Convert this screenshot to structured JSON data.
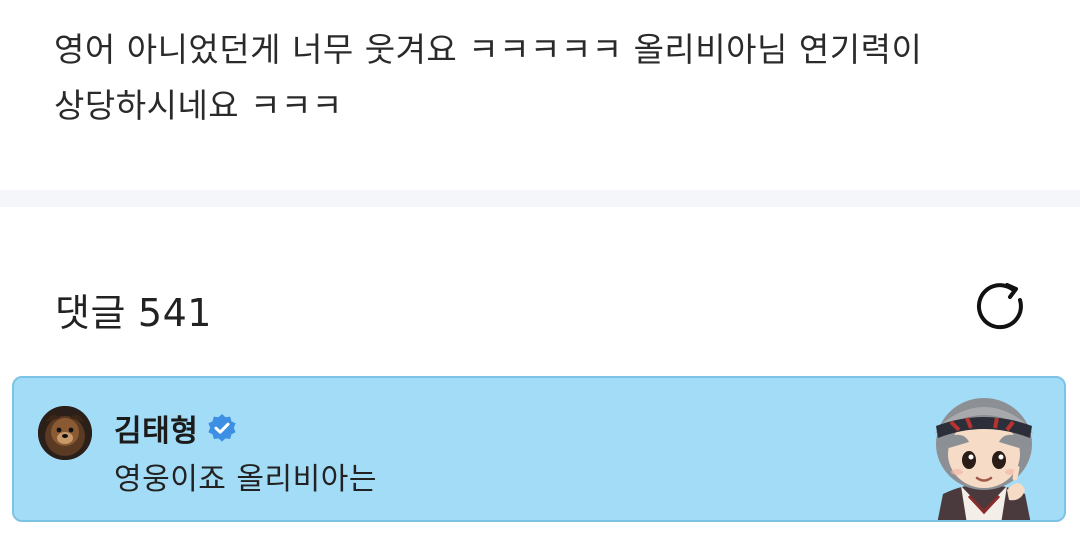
{
  "post": {
    "line1": "영어 아니었던게 너무 웃겨요 ㅋㅋㅋㅋㅋ 올리비아님 연기력이",
    "line2": "상당하시네요 ㅋㅋㅋ"
  },
  "comments": {
    "label": "댓글",
    "count": "541",
    "refresh_icon": "refresh-icon"
  },
  "comment": {
    "author": "김태형",
    "verified_icon": "verified-badge-icon",
    "text": "영웅이죠 올리비아는",
    "highlight_color": "#a3dcf6"
  }
}
